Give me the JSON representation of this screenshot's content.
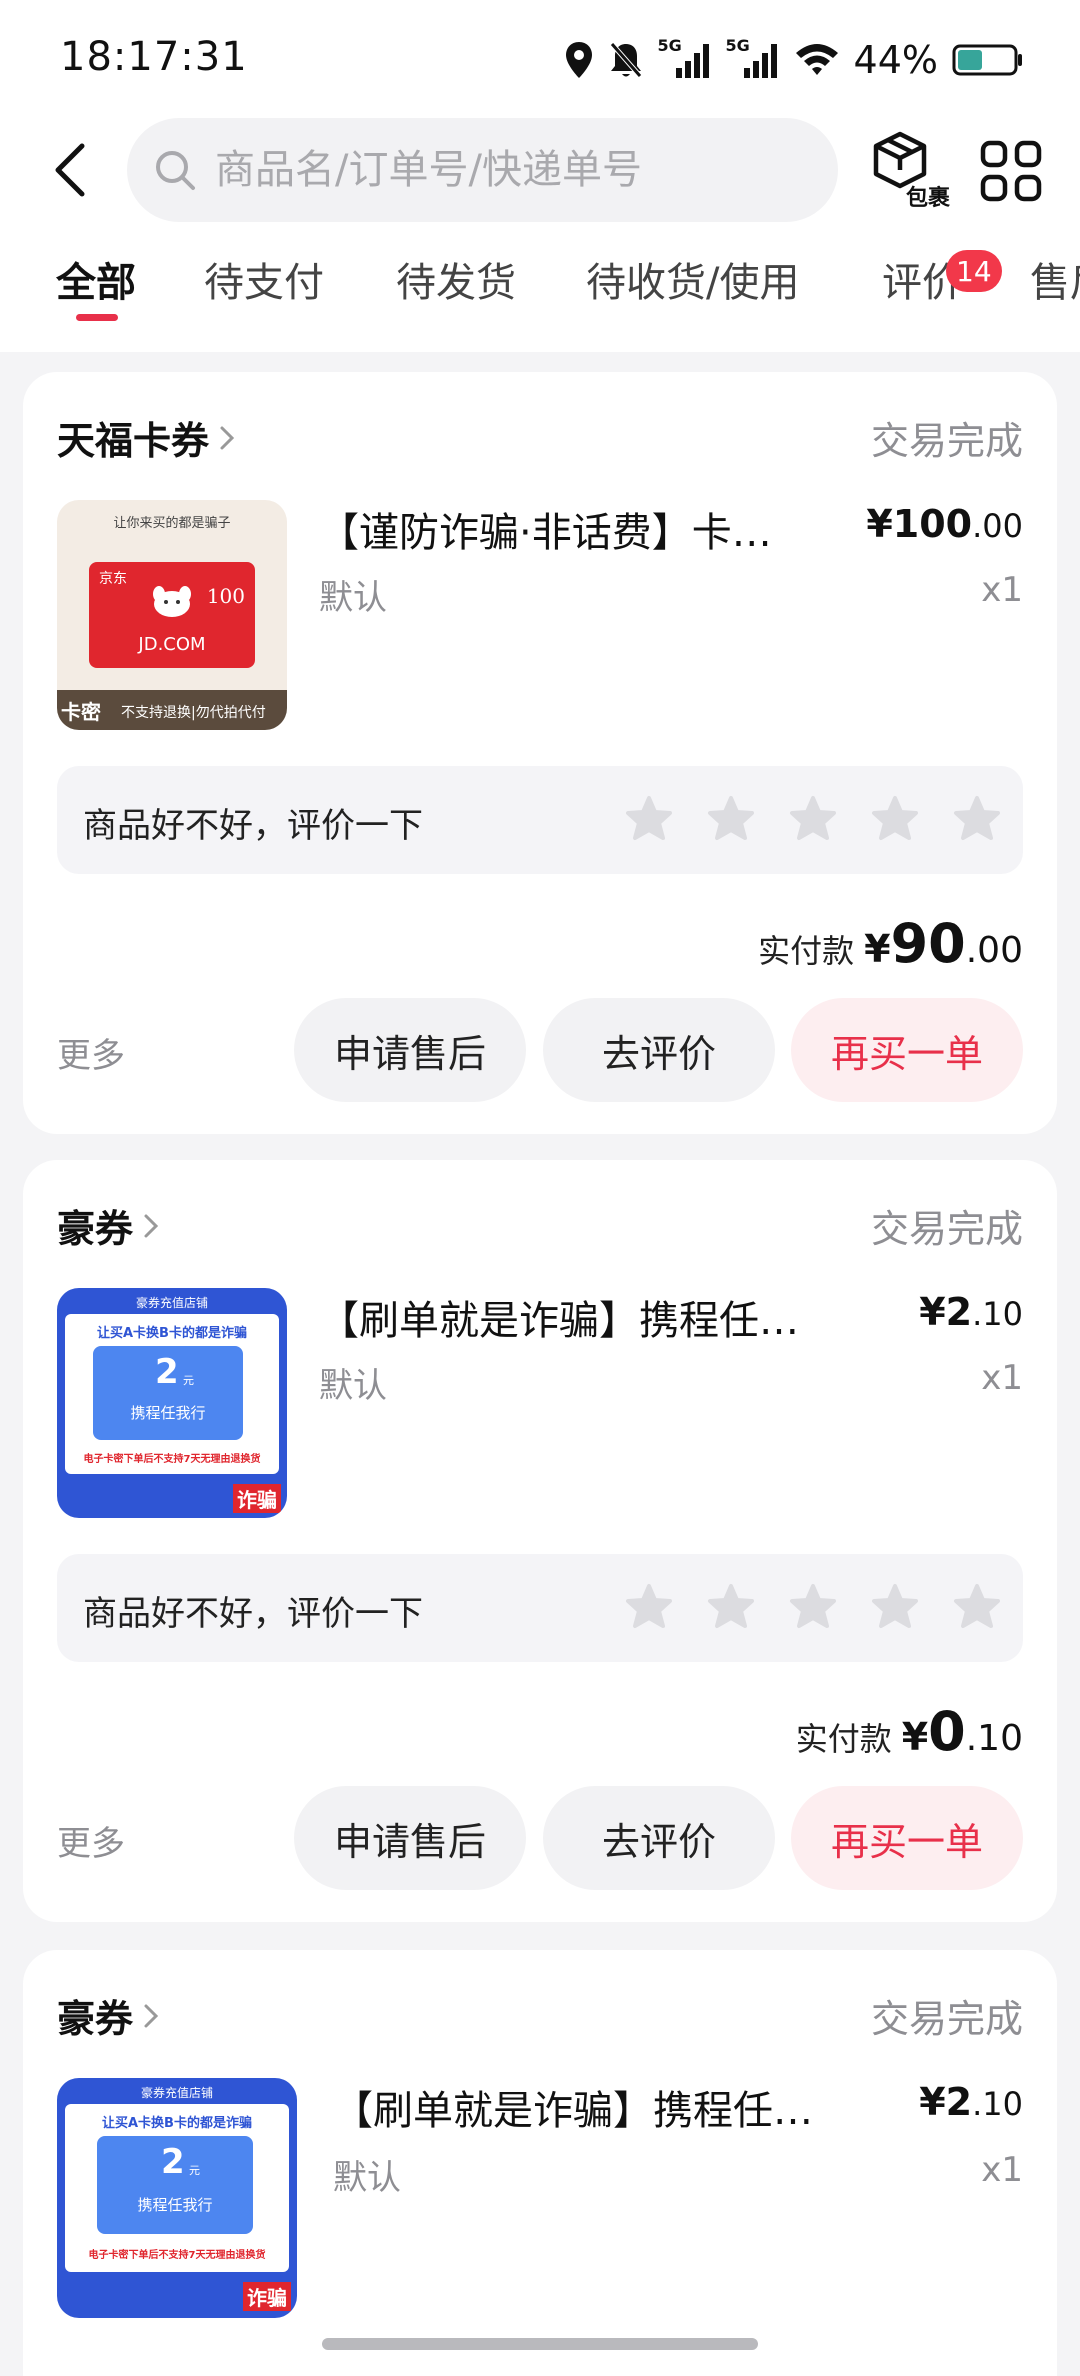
{
  "status_bar": {
    "time": "18:17:31",
    "battery_pct": "44%",
    "signal_1": "5G",
    "signal_2": "5G",
    "icons": [
      "location-icon",
      "mute-bell-icon",
      "signal-5g-icon",
      "signal-5g-icon",
      "wifi-icon",
      "battery-icon"
    ],
    "battery_level": 0.44
  },
  "search": {
    "placeholder": "商品名/订单号/快递单号"
  },
  "header": {
    "package_label": "包裹"
  },
  "tabs": [
    {
      "label": "全部",
      "active": true
    },
    {
      "label": "待支付"
    },
    {
      "label": "待发货"
    },
    {
      "label": "待收货/使用"
    },
    {
      "label": "评价",
      "badge": "14"
    },
    {
      "label": "售后"
    }
  ],
  "orders": [
    {
      "shop": "天福卡券",
      "status": "交易完成",
      "title": "【谨防诈骗·非话费】卡…",
      "spec": "默认",
      "price_int": "¥100",
      "price_dec": ".00",
      "qty": "x1",
      "review_prompt": "商品好不好，评价一下",
      "paid_label": "实付款",
      "paid_yen": "¥",
      "paid_int": "90",
      "paid_dec": ".00",
      "more": "更多",
      "btn_after_sale": "申请售后",
      "btn_review": "去评价",
      "btn_rebuy": "再买一单",
      "thumb": {
        "top_text": "让你来买的都是骗子",
        "card_brand": "京东",
        "card_value": "100",
        "card_site": "JD.COM",
        "tag": "卡密",
        "bottom_text": "不支持退换|勿代拍代付"
      }
    },
    {
      "shop": "豪券",
      "status": "交易完成",
      "title": "【刷单就是诈骗】携程任我…",
      "spec": "默认",
      "price_int": "¥2",
      "price_dec": ".10",
      "qty": "x1",
      "review_prompt": "商品好不好，评价一下",
      "paid_label": "实付款",
      "paid_yen": "¥",
      "paid_int": "0",
      "paid_dec": ".10",
      "more": "更多",
      "btn_after_sale": "申请售后",
      "btn_review": "去评价",
      "btn_rebuy": "再买一单",
      "thumb": {
        "store": "豪券充值店铺",
        "warn": "让买A卡换B卡的都是诈骗",
        "amount": "2",
        "unit": "元",
        "name": "携程任我行",
        "notice": "电子卡密下单后不支持7天无理由退换货",
        "fraud": "诈骗"
      }
    },
    {
      "shop": "豪券",
      "status": "交易完成",
      "title": "【刷单就是诈骗】携程任…",
      "spec": "默认",
      "price_int": "¥2",
      "price_dec": ".10",
      "qty": "x1",
      "thumb": {
        "store": "豪券充值店铺",
        "warn": "让买A卡换B卡的都是诈骗",
        "amount": "2",
        "unit": "元",
        "name": "携程任我行",
        "notice": "电子卡密下单后不支持7天无理由退换货",
        "fraud": "诈骗"
      }
    }
  ]
}
